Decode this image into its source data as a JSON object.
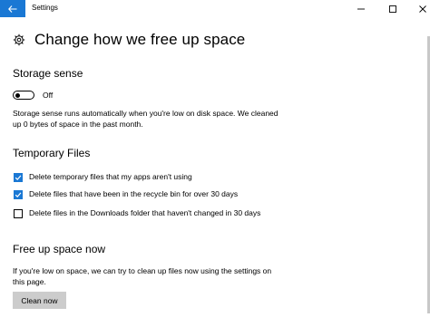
{
  "window": {
    "title": "Settings",
    "controls": {
      "minimize": "minimize",
      "maximize": "maximize",
      "close": "close"
    }
  },
  "page": {
    "title": "Change how we free up space"
  },
  "storage_sense": {
    "heading": "Storage sense",
    "toggle_state": "Off",
    "toggle_on": false,
    "description": "Storage sense runs automatically when you're low on disk space. We cleaned up 0 bytes of space in the past month."
  },
  "temporary_files": {
    "heading": "Temporary Files",
    "options": [
      {
        "label": "Delete temporary files that my apps aren't using",
        "checked": true
      },
      {
        "label": "Delete files that have been in the recycle bin for over 30 days",
        "checked": true
      },
      {
        "label": "Delete files in the Downloads folder that haven't changed in 30 days",
        "checked": false
      }
    ]
  },
  "free_up": {
    "heading": "Free up space now",
    "description": "If you're low on space, we can try to clean up files now using the settings on this page.",
    "button_label": "Clean now"
  },
  "colors": {
    "accent": "#1a78d4",
    "button_bg": "#cccccc"
  }
}
